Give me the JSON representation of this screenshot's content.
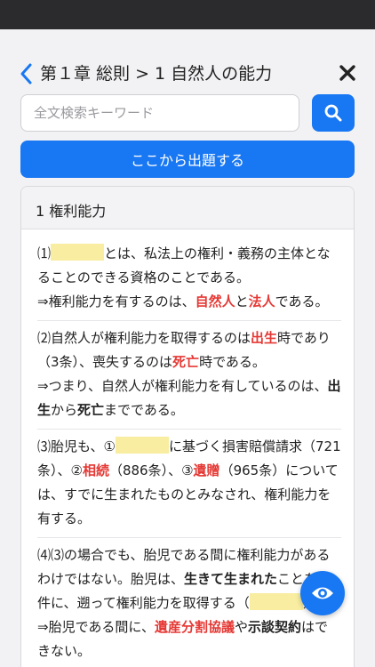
{
  "header": {
    "title": "第１章 総則 > 1 自然人の能力"
  },
  "search": {
    "placeholder": "全文検索キーワード"
  },
  "start_button_label": "ここから出題する",
  "card": {
    "title": "1 権利能力"
  },
  "items": [
    {
      "p1_marker": "⑴",
      "p1_text": "とは、私法上の権利・義務の主体となることのできる資格のことである。",
      "p2_pre": "⇒権利能力を有するのは、",
      "p2_red1": "自然人",
      "p2_mid": "と",
      "p2_red2": "法人",
      "p2_post": "である。"
    },
    {
      "p1_pre": "⑵自然人が権利能力を取得するのは",
      "p1_red1": "出生",
      "p1_mid": "時であり（3条）、喪失するのは",
      "p1_red2": "死亡",
      "p1_post": "時である。",
      "p2_pre": "⇒つまり、自然人が権利能力を有しているのは、",
      "p2_bold1": "出生",
      "p2_mid": "から",
      "p2_bold2": "死亡",
      "p2_post": "までである。"
    },
    {
      "p1_pre": "⑶胎児も、①",
      "p1_mid": "に基づく損害賠償請求（721条）、②",
      "p1_red1": "相続",
      "p1_mid2": "（886条）、③",
      "p1_red2": "遺贈",
      "p1_post": "（965条）については、すでに生まれたものとみなされ、権利能力を有する。"
    },
    {
      "p1_pre": "⑷⑶の場合でも、胎児である間に権利能力があるわけではない。胎児は、",
      "p1_bold": "生きて生まれた",
      "p1_mid": "ことを条件に、遡って権利能力を取得する（",
      "p1_post": "）。",
      "p2_pre": "⇒胎児である間に、",
      "p2_red": "遺産分割協議",
      "p2_mid": "や",
      "p2_bold": "示談契約",
      "p2_post": "はできない。"
    }
  ],
  "colors": {
    "accent": "#1877f2",
    "highlight_red": "#e53935",
    "blank_fill": "#f8eda1"
  },
  "icons": {
    "back": "chevron-left-icon",
    "close": "close-icon",
    "search": "search-icon",
    "toggle_answers": "eye-icon"
  }
}
